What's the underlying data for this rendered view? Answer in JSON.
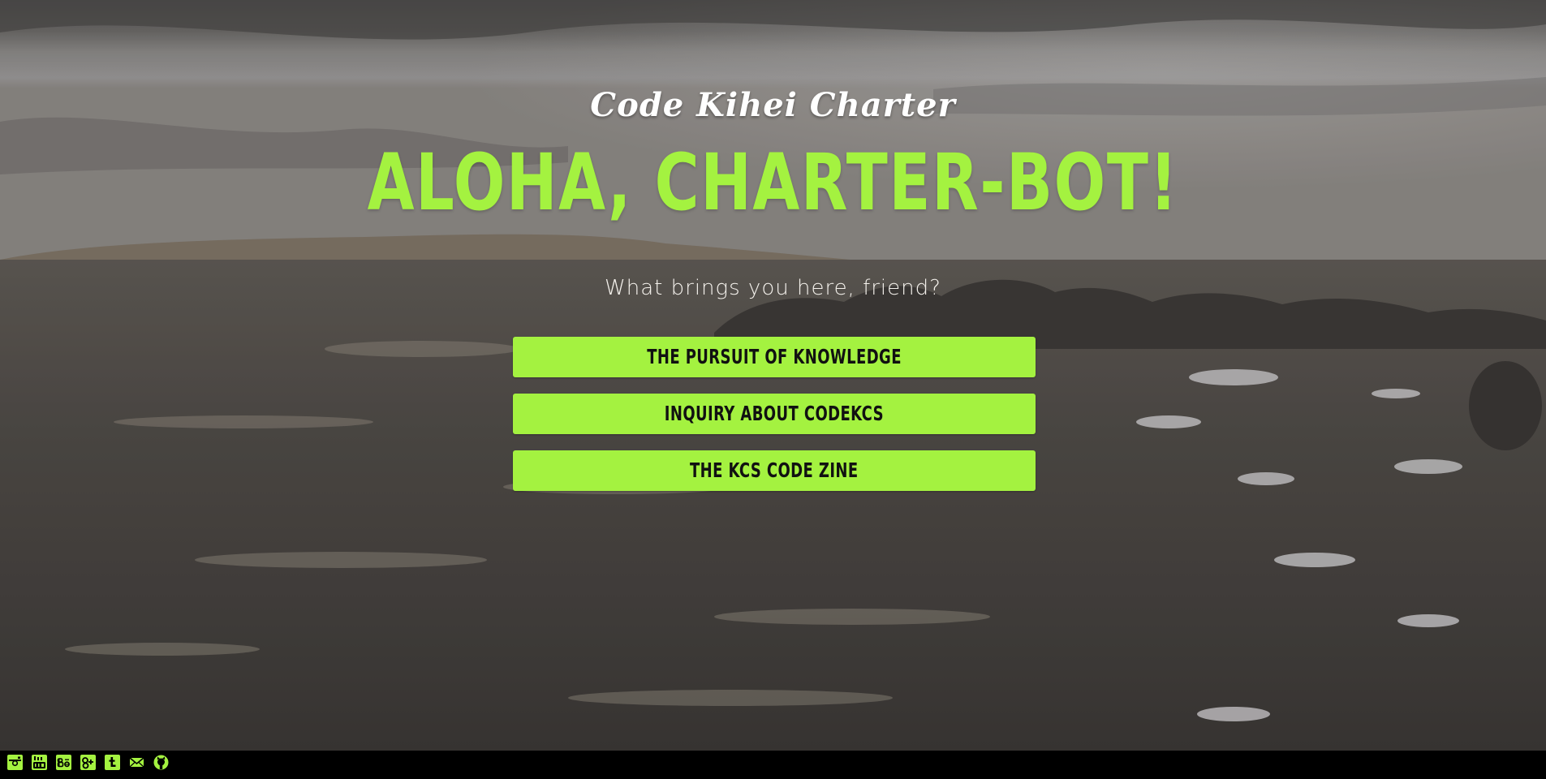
{
  "brand": "Code Kihei Charter",
  "headline": "ALOHA, CHARTER-BOT!",
  "subheadline": "What brings you here, friend?",
  "choices": [
    "THE PURSUIT OF KNOWLEDGE",
    "INQUIRY ABOUT CODEKCS",
    "THE KCS CODE ZINE"
  ],
  "social_icons": [
    "instagram-icon",
    "youtube-icon",
    "behance-icon",
    "google-plus-icon",
    "tumblr-icon",
    "email-icon",
    "github-icon"
  ],
  "colors": {
    "accent": "#a4f240",
    "button_text": "#111111",
    "footer": "#000000"
  }
}
